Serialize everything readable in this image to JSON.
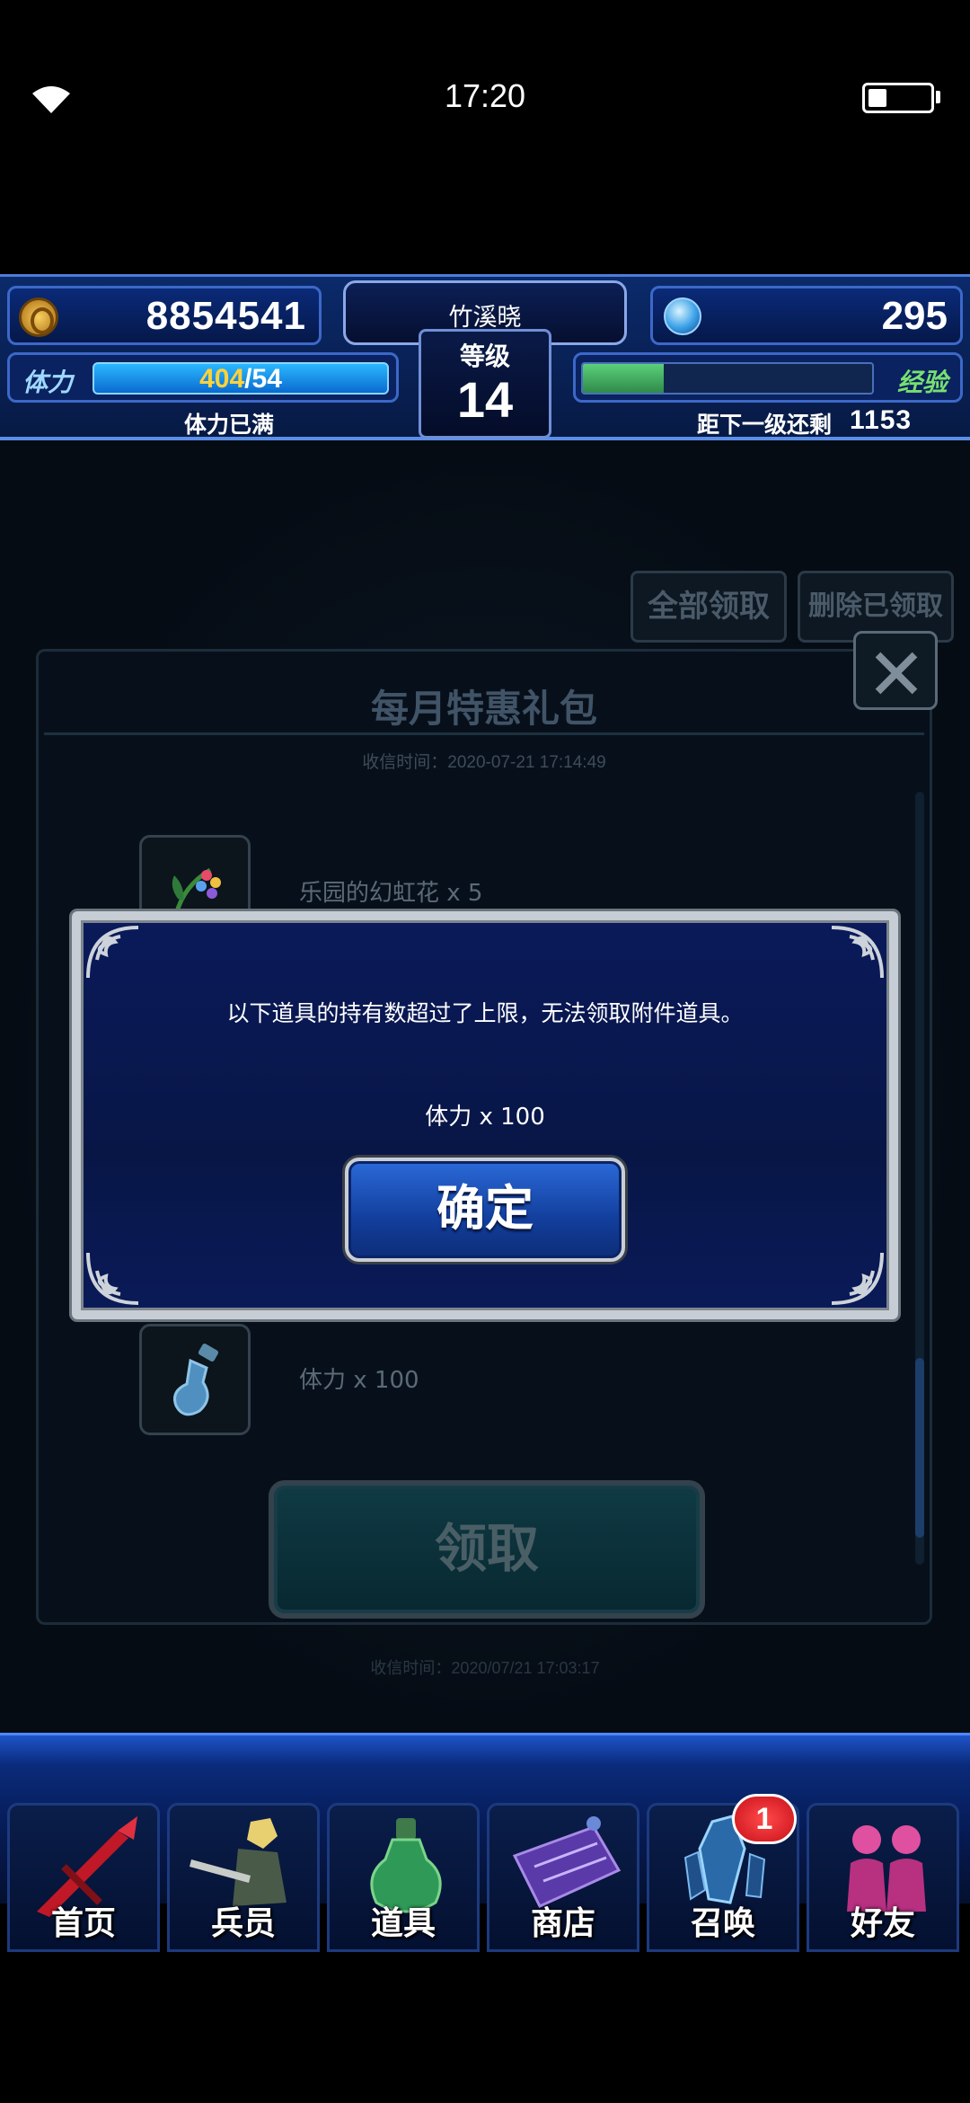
{
  "status_bar": {
    "time": "17:20",
    "battery_level": 0.3
  },
  "header": {
    "gil": "8854541",
    "gems": "295",
    "player_name": "竹溪晓",
    "level_label": "等级",
    "level": "14",
    "stamina_label": "体力",
    "stamina_current": "404",
    "stamina_max": "/54",
    "stamina_note": "体力已满",
    "exp_label": "经验",
    "exp_progress": 0.28,
    "exp_note": "距下一级还剩",
    "exp_remaining": "1153"
  },
  "mailbox": {
    "claim_all": "全部领取",
    "delete_claimed": "删除已领取",
    "mail_title": "每月特惠礼包",
    "received_time": "收信时间：2020-07-21 17:14:49",
    "items": [
      {
        "label": "乐园的幻虹花 x 5",
        "icon": "rainbow-flower-icon"
      },
      {
        "label": "体力 x 100",
        "icon": "stamina-potion-icon"
      }
    ],
    "claim_button": "领取",
    "next_mail_time": "收信时间：2020/07/21 17:03:17"
  },
  "alert": {
    "message": "以下道具的持有数超过了上限，无法领取附件道具。",
    "item": "体力 x 100",
    "confirm": "确定"
  },
  "nav": {
    "items": [
      {
        "label": "首页",
        "icon": "sword-icon"
      },
      {
        "label": "兵员",
        "icon": "warrior-icon"
      },
      {
        "label": "道具",
        "icon": "potion-icon"
      },
      {
        "label": "商店",
        "icon": "shop-icon"
      },
      {
        "label": "召唤",
        "icon": "crystal-icon"
      },
      {
        "label": "好友",
        "icon": "friends-icon"
      }
    ],
    "summon_badge": "1"
  },
  "colors": {
    "header_bg": "#0b2a6a",
    "stamina_bar": "#2ab8ff",
    "exp_bar": "#5bd07a",
    "dialog_bg": "#0a1a5a",
    "confirm_button": "#2b6ad8",
    "badge": "#e0202a"
  }
}
